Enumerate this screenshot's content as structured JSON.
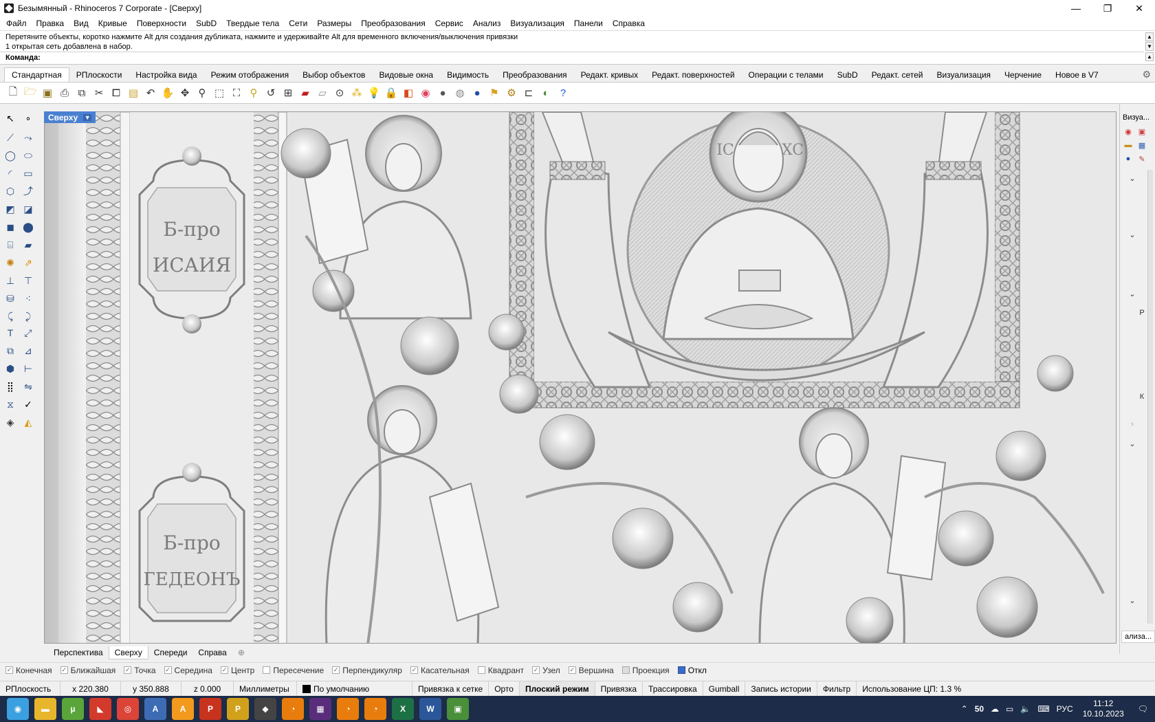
{
  "window": {
    "title": "Безымянный - Rhinoceros 7 Corporate - [Сверху]",
    "minimize": "—",
    "maximize": "❐",
    "close": "✕"
  },
  "menu": [
    "Файл",
    "Правка",
    "Вид",
    "Кривые",
    "Поверхности",
    "SubD",
    "Твердые тела",
    "Сети",
    "Размеры",
    "Преобразования",
    "Сервис",
    "Анализ",
    "Визуализация",
    "Панели",
    "Справка"
  ],
  "command": {
    "history_line1": "Перетяните объекты, коротко нажмите Alt для создания дубликата, нажмите и удерживайте Alt для временного включения/выключения привязки",
    "history_line2": "1 открытая сеть добавлена в набор.",
    "prompt": "Команда:"
  },
  "toolbar_tabs": [
    "Стандартная",
    "РПлоскости",
    "Настройка вида",
    "Режим отображения",
    "Выбор объектов",
    "Видовые окна",
    "Видимость",
    "Преобразования",
    "Редакт. кривых",
    "Редакт. поверхностей",
    "Операции с телами",
    "SubD",
    "Редакт. сетей",
    "Визуализация",
    "Черчение",
    "Новое в V7"
  ],
  "viewport": {
    "name": "Сверху",
    "plaque1_line1": "Б-про",
    "plaque1_line2": "ИСАИЯ",
    "plaque2_line1": "Б-про",
    "plaque2_line2": "ГЕДЕОНЪ",
    "halo_left": "IC",
    "halo_right": "XC"
  },
  "right_panel": {
    "header": "Визуа...",
    "footer": "ализа...",
    "letters": [
      "Р",
      "К"
    ]
  },
  "viewport_tabs": [
    "Перспектива",
    "Сверху",
    "Спереди",
    "Справа"
  ],
  "osnaps": [
    {
      "label": "Конечная",
      "checked": true
    },
    {
      "label": "Ближайшая",
      "checked": true
    },
    {
      "label": "Точка",
      "checked": true
    },
    {
      "label": "Середина",
      "checked": true
    },
    {
      "label": "Центр",
      "checked": true
    },
    {
      "label": "Пересечение",
      "checked": false
    },
    {
      "label": "Перпендикуляр",
      "checked": true
    },
    {
      "label": "Касательная",
      "checked": true
    },
    {
      "label": "Квадрант",
      "checked": false
    },
    {
      "label": "Узел",
      "checked": true
    },
    {
      "label": "Вершина",
      "checked": true
    },
    {
      "label": "Проекция",
      "checked": false
    },
    {
      "label": "Откл",
      "checked": false,
      "filled": true
    }
  ],
  "status": {
    "cplane": "РПлоскость",
    "x": "x 220.380",
    "y": "y 350.888",
    "z": "z 0.000",
    "units": "Миллиметры",
    "layer": "По умолчанию",
    "grid_snap": "Привязка к сетке",
    "ortho": "Орто",
    "planar": "Плоский режим",
    "osnap": "Привязка",
    "smarttrack": "Трассировка",
    "gumball": "Gumball",
    "history": "Запись истории",
    "filter": "Фильтр",
    "cpu": "Использование ЦП: 1.3 %"
  },
  "taskbar": {
    "apps": [
      {
        "icon": "windows-start-icon",
        "color": "#3aa0e0",
        "glyph": "◉"
      },
      {
        "icon": "file-explorer-icon",
        "color": "#e8b62c",
        "glyph": "▬"
      },
      {
        "icon": "utorrent-icon",
        "color": "#5aa53a",
        "glyph": "µ"
      },
      {
        "icon": "slicer-icon",
        "color": "#d33a2c",
        "glyph": "◣"
      },
      {
        "icon": "chrome-icon",
        "color": "#db4437",
        "glyph": "◎"
      },
      {
        "icon": "artcam-icon",
        "color": "#3d6cb5",
        "glyph": "A"
      },
      {
        "icon": "illustrator-icon",
        "color": "#f29a1d",
        "glyph": "A"
      },
      {
        "icon": "powermill-icon",
        "color": "#c8331e",
        "glyph": "P"
      },
      {
        "icon": "powershape-icon",
        "color": "#d2a11c",
        "glyph": "P"
      },
      {
        "icon": "rhino-icon",
        "color": "#444",
        "glyph": "◆"
      },
      {
        "icon": "blender-icon",
        "color": "#e87d0d",
        "glyph": "◔"
      },
      {
        "icon": "film-icon",
        "color": "#5a2d7c",
        "glyph": "▦"
      },
      {
        "icon": "blender-icon-2",
        "color": "#e87d0d",
        "glyph": "◔"
      },
      {
        "icon": "blender-icon-3",
        "color": "#e87d0d",
        "glyph": "◔"
      },
      {
        "icon": "excel-icon",
        "color": "#1d7044",
        "glyph": "X"
      },
      {
        "icon": "word-icon",
        "color": "#2b579a",
        "glyph": "W"
      },
      {
        "icon": "image-viewer-icon",
        "color": "#4a8f3a",
        "glyph": "▣"
      }
    ],
    "tray_count": "50",
    "lang": "РУС",
    "time": "11:12",
    "date": "10.10.2023"
  },
  "colors": {
    "viewport_label_bg": "#4a80d0",
    "relief_light": "#f2f2f2",
    "relief_shadow": "#8a8a8a",
    "taskbar_bg": "#1d2c48"
  }
}
